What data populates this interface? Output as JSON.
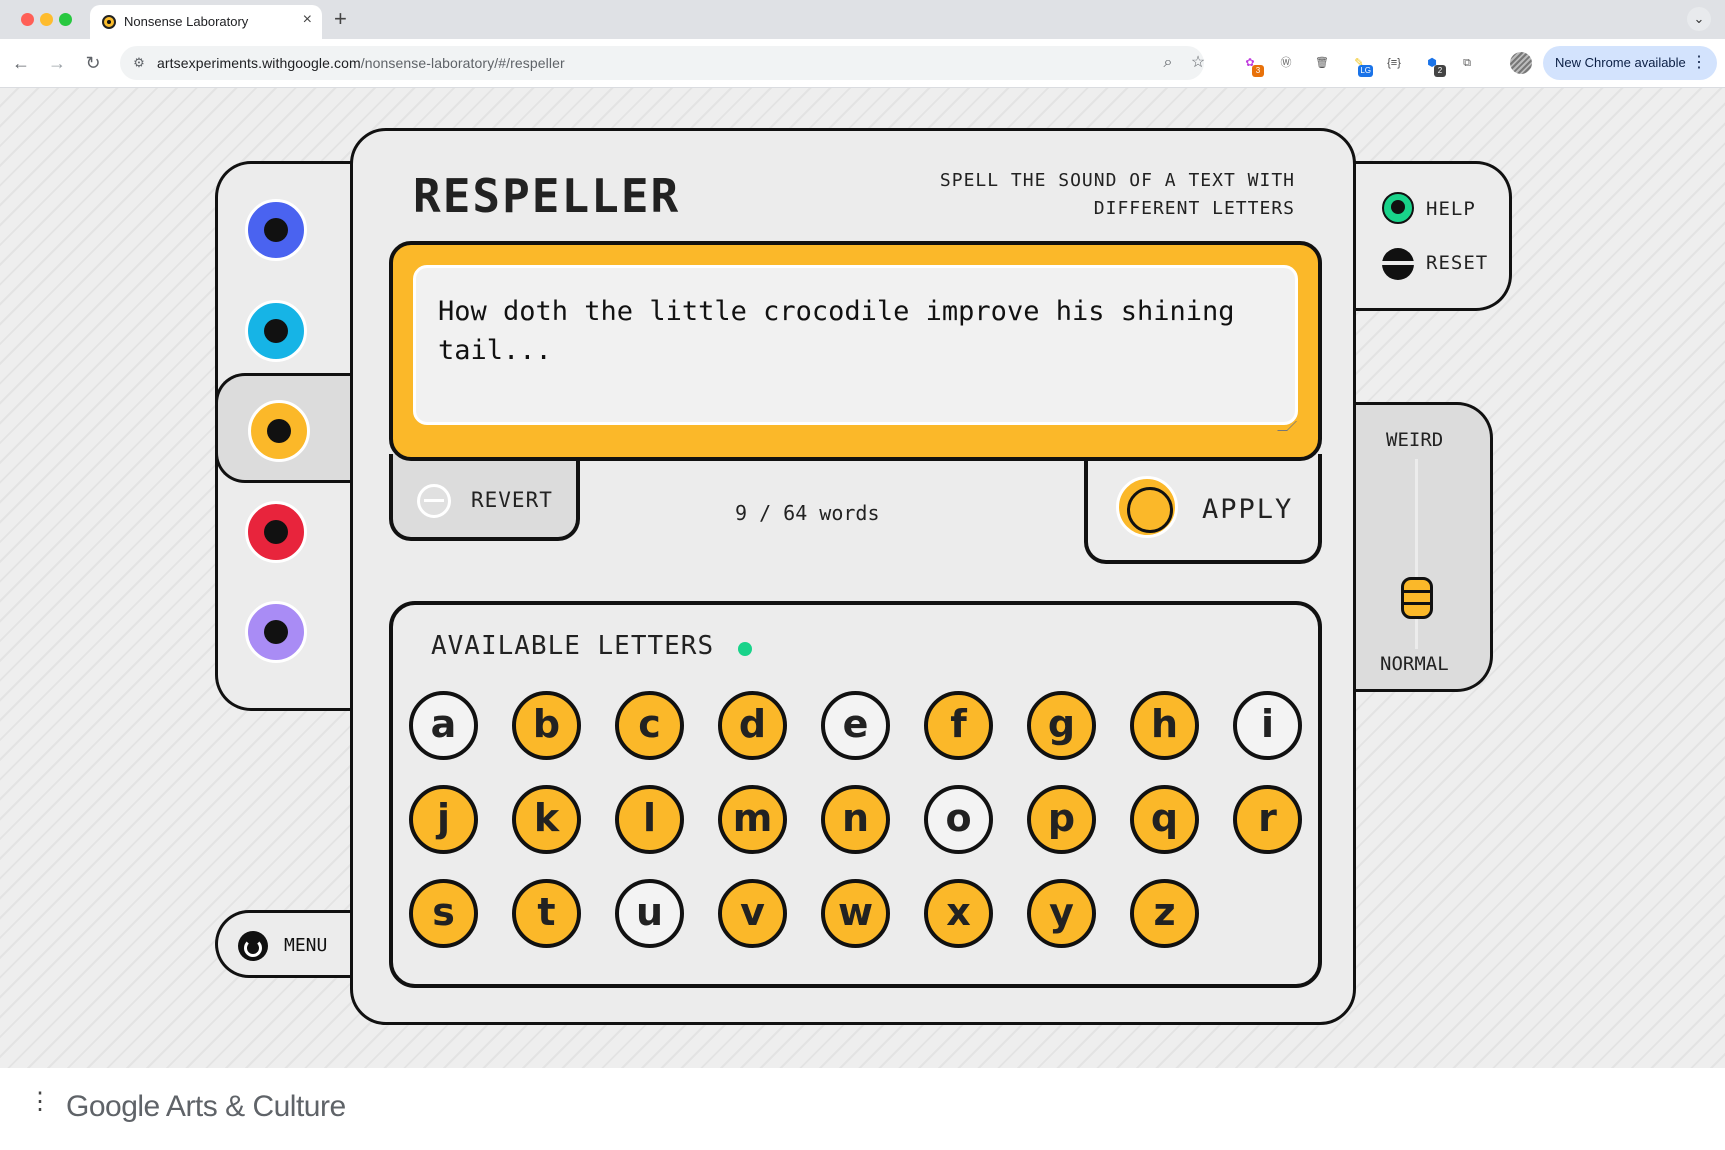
{
  "browser": {
    "tab_title": "Nonsense Laboratory",
    "tab_close": "×",
    "new_tab": "+",
    "tabs_menu": "⌄",
    "back": "←",
    "forward": "→",
    "reload": "↻",
    "url_host": "artsexperiments.withgoogle.com",
    "url_path": "/nonsense-laboratory/#/respeller",
    "zoom_icon": "⌕",
    "bookmark_icon": "☆",
    "update_label": "New Chrome available",
    "update_menu": "⋮",
    "extensions": [
      {
        "name": "ext-puzzle-3",
        "glyph": "✿",
        "badge": "3",
        "color": "#c03ddf",
        "badge_color": "#e8710a"
      },
      {
        "name": "ext-wordpress",
        "glyph": "Ⓦ",
        "badge": "",
        "color": "#6b6b6b",
        "badge_color": ""
      },
      {
        "name": "ext-trash",
        "glyph": "🗑",
        "badge": "",
        "color": "#555555",
        "badge_color": ""
      },
      {
        "name": "ext-lg",
        "glyph": "✎",
        "badge": "LG",
        "color": "#f0c419",
        "badge_color": "#1a73e8"
      },
      {
        "name": "ext-braces",
        "glyph": "{≡}",
        "badge": "",
        "color": "#444444",
        "badge_color": ""
      },
      {
        "name": "ext-blue-2",
        "glyph": "⬢",
        "badge": "2",
        "color": "#1a73e8",
        "badge_color": "#444444"
      },
      {
        "name": "ext-puzzle",
        "glyph": "⧉",
        "badge": "",
        "color": "#555555",
        "badge_color": ""
      }
    ]
  },
  "app": {
    "title": "RESPELLER",
    "subtitle": "SPELL THE SOUND OF A TEXT WITH DIFFERENT LETTERS",
    "text": "How doth the little crocodile improve his shining tail...",
    "revert_label": "REVERT",
    "word_count": "9 / 64 words",
    "apply_label": "APPLY",
    "letters_title": "AVAILABLE LETTERS",
    "letters": [
      {
        "char": "a",
        "on": false
      },
      {
        "char": "b",
        "on": true
      },
      {
        "char": "c",
        "on": true
      },
      {
        "char": "d",
        "on": true
      },
      {
        "char": "e",
        "on": false
      },
      {
        "char": "f",
        "on": true
      },
      {
        "char": "g",
        "on": true
      },
      {
        "char": "h",
        "on": true
      },
      {
        "char": "i",
        "on": false
      },
      {
        "char": "j",
        "on": true
      },
      {
        "char": "k",
        "on": true
      },
      {
        "char": "l",
        "on": true
      },
      {
        "char": "m",
        "on": true
      },
      {
        "char": "n",
        "on": true
      },
      {
        "char": "o",
        "on": false
      },
      {
        "char": "p",
        "on": true
      },
      {
        "char": "q",
        "on": true
      },
      {
        "char": "r",
        "on": true
      },
      {
        "char": "s",
        "on": true
      },
      {
        "char": "t",
        "on": true
      },
      {
        "char": "u",
        "on": false
      },
      {
        "char": "v",
        "on": true
      },
      {
        "char": "w",
        "on": true
      },
      {
        "char": "x",
        "on": true
      },
      {
        "char": "y",
        "on": true
      },
      {
        "char": "z",
        "on": true
      }
    ],
    "help_label": "HELP",
    "reset_label": "RESET",
    "slider_top_label": "WEIRD",
    "slider_bottom_label": "NORMAL",
    "slider_level": 0.27,
    "menu_label": "MENU",
    "experiments": [
      {
        "name": "blue",
        "color": "#4a63f0",
        "active": false
      },
      {
        "name": "cyan",
        "color": "#16b4e6",
        "active": false
      },
      {
        "name": "yellow",
        "color": "#fbb829",
        "active": true
      },
      {
        "name": "red",
        "color": "#e8243c",
        "active": false
      },
      {
        "name": "purple",
        "color": "#a98cf5",
        "active": false
      }
    ]
  },
  "footer": {
    "menu_icon": "⋮",
    "logo_google": "Google",
    "logo_rest": " Arts & Culture"
  }
}
